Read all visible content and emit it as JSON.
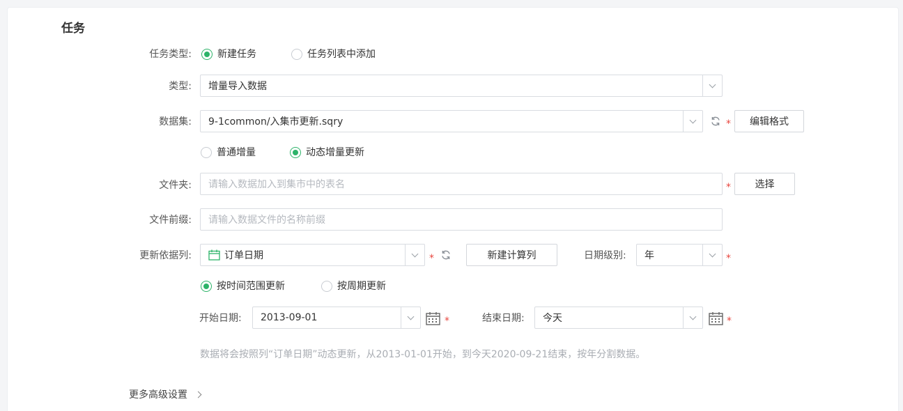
{
  "section_title": "任务",
  "task_type": {
    "label": "任务类型:",
    "options": [
      "新建任务",
      "任务列表中添加"
    ],
    "selected": "新建任务"
  },
  "type": {
    "label": "类型:",
    "value": "增量导入数据"
  },
  "dataset": {
    "label": "数据集:",
    "value": "9-1common/入集市更新.sqry",
    "edit_button": "编辑格式",
    "required_mark": "*"
  },
  "increment_mode": {
    "options": [
      "普通增量",
      "动态增量更新"
    ],
    "selected": "动态增量更新"
  },
  "folder": {
    "label": "文件夹:",
    "placeholder": "请输入数据加入到集市中的表名",
    "select_button": "选择",
    "required_mark": "*"
  },
  "file_prefix": {
    "label": "文件前缀:",
    "placeholder": "请输入数据文件的名称前缀"
  },
  "update_column": {
    "label": "更新依据列:",
    "value": "订单日期",
    "required_mark": "*",
    "new_calc_button": "新建计算列",
    "date_level_label": "日期级别:",
    "date_level_value": "年",
    "date_level_required": "*"
  },
  "update_by": {
    "options": [
      "按时间范围更新",
      "按周期更新"
    ],
    "selected": "按时间范围更新"
  },
  "start_date": {
    "label": "开始日期:",
    "value": "2013-09-01",
    "required_mark": "*"
  },
  "end_date": {
    "label": "结束日期:",
    "value": "今天",
    "required_mark": "*"
  },
  "hint_text": "数据将会按照列“订单日期”动态更新，从2013-01-01开始，到今天2020-09-21结束，按年分割数据。",
  "more_settings": "更多高级设置",
  "colors": {
    "accent": "#2db369",
    "required": "#e8473f",
    "border": "#d9dce1"
  }
}
